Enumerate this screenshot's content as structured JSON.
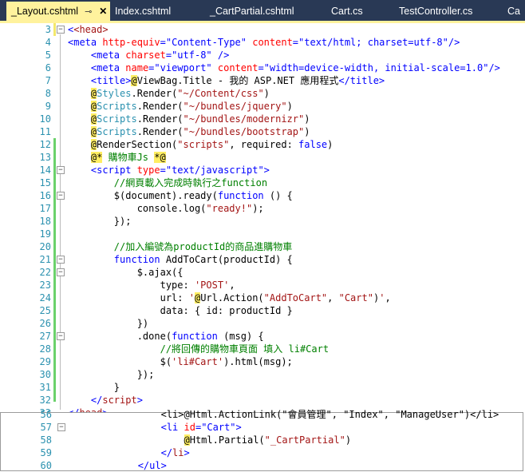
{
  "tabs": [
    {
      "label": "_Layout.cshtml",
      "active": true
    },
    {
      "label": "Index.cshtml"
    },
    {
      "label": "_CartPartial.cshtml"
    },
    {
      "label": "Cart.cs"
    },
    {
      "label": "TestController.cs"
    },
    {
      "label": "Ca"
    }
  ],
  "tab_icons": {
    "pin": "pin-icon",
    "close": "close-icon"
  },
  "colors": {
    "tab_active": "#fff29d",
    "tab_bar": "#293955",
    "line_numbers": "#2b91af",
    "changed_bar": "#6bd16b"
  },
  "editor_lines": [
    {
      "n": "3"
    },
    {
      "n": "4"
    },
    {
      "n": "5"
    },
    {
      "n": "6"
    },
    {
      "n": "7"
    },
    {
      "n": "8"
    },
    {
      "n": "9"
    },
    {
      "n": "10"
    },
    {
      "n": "11"
    },
    {
      "n": "12"
    },
    {
      "n": "13"
    },
    {
      "n": "14"
    },
    {
      "n": "15"
    },
    {
      "n": "16"
    },
    {
      "n": "17"
    },
    {
      "n": "18"
    },
    {
      "n": "19"
    },
    {
      "n": "20"
    },
    {
      "n": "21"
    },
    {
      "n": "22"
    },
    {
      "n": "23"
    },
    {
      "n": "24"
    },
    {
      "n": "25"
    },
    {
      "n": "26"
    },
    {
      "n": "27"
    },
    {
      "n": "28"
    },
    {
      "n": "29"
    },
    {
      "n": "30"
    },
    {
      "n": "31"
    },
    {
      "n": "32"
    },
    {
      "n": "33"
    }
  ],
  "split_lines": [
    {
      "n": "56"
    },
    {
      "n": "57"
    },
    {
      "n": "58"
    },
    {
      "n": "59"
    },
    {
      "n": "60"
    }
  ],
  "text": {
    "l3": "<head>",
    "l4_a": "<meta ",
    "l4_b": "http-equiv",
    "l4_c": "=",
    "l4_d": "\"Content-Type\"",
    "l4_e": " content",
    "l4_f": "=",
    "l4_g": "\"text/html; charset=utf-8\"",
    "l4_h": "/>",
    "l5_a": "<meta ",
    "l5_b": "charset",
    "l5_c": "=",
    "l5_d": "\"utf-8\"",
    "l5_e": " />",
    "l6_a": "<meta ",
    "l6_b": "name",
    "l6_c": "=",
    "l6_d": "\"viewport\"",
    "l6_e": " content",
    "l6_f": "=",
    "l6_g": "\"width=device-width, initial-scale=1.0\"",
    "l6_h": "/>",
    "l7_a": "<title>",
    "l7_b": "@",
    "l7_c": "ViewBag.Title - 我的 ASP.NET 應用程式",
    "l7_d": "</title>",
    "l8_a": "@",
    "l8_b": "Styles",
    "l8_c": ".Render(",
    "l8_d": "\"~/Content/css\"",
    "l8_e": ")",
    "l9_a": "@",
    "l9_b": "Scripts",
    "l9_c": ".Render(",
    "l9_d": "\"~/bundles/jquery\"",
    "l9_e": ")",
    "l10_a": "@",
    "l10_b": "Scripts",
    "l10_c": ".Render(",
    "l10_d": "\"~/bundles/modernizr\"",
    "l10_e": ")",
    "l11_a": "@",
    "l11_b": "Scripts",
    "l11_c": ".Render(",
    "l11_d": "\"~/bundles/bootstrap\"",
    "l11_e": ")",
    "l12_a": "@",
    "l12_b": "RenderSection(",
    "l12_c": "\"scripts\"",
    "l12_d": ", required: ",
    "l12_e": "false",
    "l12_f": ")",
    "l13_a": "@*",
    "l13_b": " 購物車Js ",
    "l13_c": "*@",
    "l14_a": "<script ",
    "l14_b": "type",
    "l14_c": "=",
    "l14_d": "\"text/javascript\"",
    "l14_e": ">",
    "l15": "//網頁載入完成時執行之function",
    "l16_a": "$(document).ready(",
    "l16_b": "function",
    "l16_c": " () {",
    "l17_a": "console.log(",
    "l17_b": "\"ready!\"",
    "l17_c": ");",
    "l18": "});",
    "l20": "//加入編號為productId的商品進購物車",
    "l21_a": "function",
    "l21_b": " AddToCart(productId) {",
    "l22": "$.ajax({",
    "l23_a": "type: ",
    "l23_b": "'POST'",
    "l23_c": ",",
    "l24_a": "url: ",
    "l24_b": "'",
    "l24_c": "@",
    "l24_d": "Url.Action(",
    "l24_e": "\"AddToCart\"",
    "l24_f": ", ",
    "l24_g": "\"Cart\"",
    "l24_h": ")",
    "l24_i": "'",
    "l24_j": ",",
    "l25": "data: { id: productId }",
    "l26": "})",
    "l27_a": ".done(",
    "l27_b": "function",
    "l27_c": " (msg) {",
    "l28": "//將回傳的購物車頁面 填入 li#Cart",
    "l29_a": "$(",
    "l29_b": "'li#Cart'",
    "l29_c": ").html(msg);",
    "l30": "});",
    "l31": "}",
    "l32_a": "</",
    "l32_b": "script",
    "l32_c": ">",
    "l33_a": "</",
    "l33_b": "head",
    "l33_c": ">",
    "s56": "<li>@Html.ActionLink(\"會員管理\", \"Index\", \"ManageUser\")</li>",
    "s57_a": "<li ",
    "s57_b": "id",
    "s57_c": "=",
    "s57_d": "\"Cart\"",
    "s57_e": ">",
    "s58_a": "@",
    "s58_b": "Html.Partial(",
    "s58_c": "\"_CartPartial\"",
    "s58_d": ")",
    "s59_a": "</",
    "s59_b": "li",
    "s59_c": ">",
    "s60": "</ul>"
  }
}
